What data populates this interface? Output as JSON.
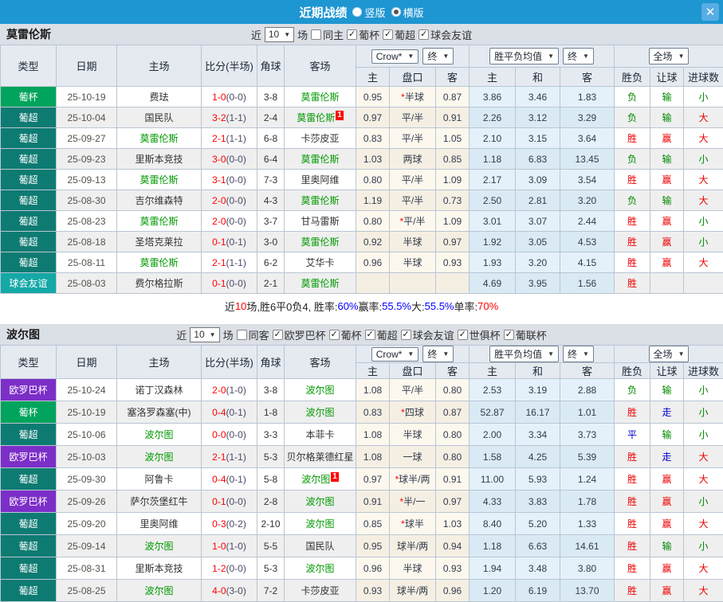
{
  "titlebar": {
    "title": "近期战绩",
    "options": [
      {
        "label": "竖版",
        "checked": false
      },
      {
        "label": "横版",
        "checked": true
      }
    ],
    "close_icon": "✕",
    "bar_color": "#1e96d2"
  },
  "headers": {
    "main": [
      "类型",
      "日期",
      "主场",
      "比分(半场)",
      "角球",
      "客场"
    ],
    "odds_sub": [
      "主",
      "盘口",
      "客"
    ],
    "mean_sub": [
      "主",
      "和",
      "客"
    ],
    "result_sub": [
      "胜负",
      "让球",
      "进球数"
    ],
    "odds_dropdown": "Crow*",
    "odds_final_dropdown": "终",
    "mean_dropdown": "胜平负均值",
    "mean_final_dropdown": "终",
    "scope_dropdown": "全场",
    "arrow_icon": "▼",
    "check_icon": "✓"
  },
  "type_colors": {
    "葡杯": "#00a45c",
    "葡超": "#0e7b72",
    "球会友谊": "#14a8a6",
    "欧罗巴杯": "#7c2fc8"
  },
  "sections": [
    {
      "team": "莫雷伦斯",
      "filter": {
        "prefix": "近",
        "count": "10",
        "suffix": "场",
        "same": {
          "label": "同主",
          "checked": false
        },
        "leagues": [
          {
            "label": "葡杯",
            "checked": true
          },
          {
            "label": "葡超",
            "checked": true
          },
          {
            "label": "球会友谊",
            "checked": true
          }
        ]
      },
      "rows": [
        {
          "type": "葡杯",
          "date": "25-10-19",
          "home": {
            "name": "费珐",
            "self": false,
            "card": ""
          },
          "score": "1-0",
          "half": "0-0",
          "corner": "3-8",
          "away": {
            "name": "莫雷伦斯",
            "self": true,
            "card": ""
          },
          "odds": [
            "0.95",
            "*半球",
            "0.87"
          ],
          "mean": [
            "3.86",
            "3.46",
            "1.83"
          ],
          "result": [
            "负",
            "输",
            "小"
          ]
        },
        {
          "type": "葡超",
          "date": "25-10-04",
          "home": {
            "name": "国民队",
            "self": false,
            "card": ""
          },
          "score": "3-2",
          "half": "1-1",
          "corner": "2-4",
          "away": {
            "name": "莫雷伦斯",
            "self": true,
            "card": "1"
          },
          "odds": [
            "0.97",
            "平/半",
            "0.91"
          ],
          "mean": [
            "2.26",
            "3.12",
            "3.29"
          ],
          "result": [
            "负",
            "输",
            "大"
          ]
        },
        {
          "type": "葡超",
          "date": "25-09-27",
          "home": {
            "name": "莫雷伦斯",
            "self": true,
            "card": ""
          },
          "score": "2-1",
          "half": "1-1",
          "corner": "6-8",
          "away": {
            "name": "卡莎皮亚",
            "self": false,
            "card": ""
          },
          "odds": [
            "0.83",
            "平/半",
            "1.05"
          ],
          "mean": [
            "2.10",
            "3.15",
            "3.64"
          ],
          "result": [
            "胜",
            "赢",
            "大"
          ]
        },
        {
          "type": "葡超",
          "date": "25-09-23",
          "home": {
            "name": "里斯本竞技",
            "self": false,
            "card": ""
          },
          "score": "3-0",
          "half": "0-0",
          "corner": "6-4",
          "away": {
            "name": "莫雷伦斯",
            "self": true,
            "card": ""
          },
          "odds": [
            "1.03",
            "两球",
            "0.85"
          ],
          "mean": [
            "1.18",
            "6.83",
            "13.45"
          ],
          "result": [
            "负",
            "输",
            "小"
          ]
        },
        {
          "type": "葡超",
          "date": "25-09-13",
          "home": {
            "name": "莫雷伦斯",
            "self": true,
            "card": ""
          },
          "score": "3-1",
          "half": "0-0",
          "corner": "7-3",
          "away": {
            "name": "里奥阿维",
            "self": false,
            "card": ""
          },
          "odds": [
            "0.80",
            "平/半",
            "1.09"
          ],
          "mean": [
            "2.17",
            "3.09",
            "3.54"
          ],
          "result": [
            "胜",
            "赢",
            "大"
          ]
        },
        {
          "type": "葡超",
          "date": "25-08-30",
          "home": {
            "name": "吉尔维森特",
            "self": false,
            "card": ""
          },
          "score": "2-0",
          "half": "0-0",
          "corner": "4-3",
          "away": {
            "name": "莫雷伦斯",
            "self": true,
            "card": ""
          },
          "odds": [
            "1.19",
            "平/半",
            "0.73"
          ],
          "mean": [
            "2.50",
            "2.81",
            "3.20"
          ],
          "result": [
            "负",
            "输",
            "大"
          ]
        },
        {
          "type": "葡超",
          "date": "25-08-23",
          "home": {
            "name": "莫雷伦斯",
            "self": true,
            "card": ""
          },
          "score": "2-0",
          "half": "0-0",
          "corner": "3-7",
          "away": {
            "name": "甘马雷斯",
            "self": false,
            "card": ""
          },
          "odds": [
            "0.80",
            "*平/半",
            "1.09"
          ],
          "mean": [
            "3.01",
            "3.07",
            "2.44"
          ],
          "result": [
            "胜",
            "赢",
            "小"
          ]
        },
        {
          "type": "葡超",
          "date": "25-08-18",
          "home": {
            "name": "圣塔克莱拉",
            "self": false,
            "card": ""
          },
          "score": "0-1",
          "half": "0-1",
          "corner": "3-0",
          "away": {
            "name": "莫雷伦斯",
            "self": true,
            "card": ""
          },
          "odds": [
            "0.92",
            "半球",
            "0.97"
          ],
          "mean": [
            "1.92",
            "3.05",
            "4.53"
          ],
          "result": [
            "胜",
            "赢",
            "小"
          ]
        },
        {
          "type": "葡超",
          "date": "25-08-11",
          "home": {
            "name": "莫雷伦斯",
            "self": true,
            "card": ""
          },
          "score": "2-1",
          "half": "1-1",
          "corner": "6-2",
          "away": {
            "name": "艾华卡",
            "self": false,
            "card": ""
          },
          "odds": [
            "0.96",
            "半球",
            "0.93"
          ],
          "mean": [
            "1.93",
            "3.20",
            "4.15"
          ],
          "result": [
            "胜",
            "赢",
            "大"
          ]
        },
        {
          "type": "球会友谊",
          "date": "25-08-03",
          "home": {
            "name": "费尔格拉斯",
            "self": false,
            "card": ""
          },
          "score": "0-1",
          "half": "0-0",
          "corner": "2-1",
          "away": {
            "name": "莫雷伦斯",
            "self": true,
            "card": ""
          },
          "odds": [
            "",
            "",
            ""
          ],
          "mean": [
            "4.69",
            "3.95",
            "1.56"
          ],
          "result": [
            "胜",
            "",
            ""
          ]
        }
      ],
      "summary": [
        {
          "text": "近",
          "color": "dark"
        },
        {
          "text": "10",
          "color": "red"
        },
        {
          "text": "场,胜6平0负4, 胜率:",
          "color": "dark"
        },
        {
          "text": "60%",
          "color": "blue"
        },
        {
          "text": " 赢率:",
          "color": "dark"
        },
        {
          "text": "55.5%",
          "color": "blue"
        },
        {
          "text": " 大:",
          "color": "dark"
        },
        {
          "text": "55.5%",
          "color": "blue"
        },
        {
          "text": " 单率:",
          "color": "dark"
        },
        {
          "text": "70%",
          "color": "red"
        }
      ]
    },
    {
      "team": "波尔图",
      "filter": {
        "prefix": "近",
        "count": "10",
        "suffix": "场",
        "same": {
          "label": "同客",
          "checked": false
        },
        "leagues": [
          {
            "label": "欧罗巴杯",
            "checked": true
          },
          {
            "label": "葡杯",
            "checked": true
          },
          {
            "label": "葡超",
            "checked": true
          },
          {
            "label": "球会友谊",
            "checked": true
          },
          {
            "label": "世俱杯",
            "checked": true
          },
          {
            "label": "葡联杯",
            "checked": true
          }
        ]
      },
      "rows": [
        {
          "type": "欧罗巴杯",
          "date": "25-10-24",
          "home": {
            "name": "诺丁汉森林",
            "self": false,
            "card": ""
          },
          "score": "2-0",
          "half": "1-0",
          "corner": "3-8",
          "away": {
            "name": "波尔图",
            "self": true,
            "card": ""
          },
          "odds": [
            "1.08",
            "平/半",
            "0.80"
          ],
          "mean": [
            "2.53",
            "3.19",
            "2.88"
          ],
          "result": [
            "负",
            "输",
            "小"
          ]
        },
        {
          "type": "葡杯",
          "date": "25-10-19",
          "home": {
            "name": "塞洛罗森塞(中)",
            "self": false,
            "card": ""
          },
          "score": "0-4",
          "half": "0-1",
          "corner": "1-8",
          "away": {
            "name": "波尔图",
            "self": true,
            "card": ""
          },
          "odds": [
            "0.83",
            "*四球",
            "0.87"
          ],
          "mean": [
            "52.87",
            "16.17",
            "1.01"
          ],
          "result": [
            "胜",
            "走",
            "小"
          ]
        },
        {
          "type": "葡超",
          "date": "25-10-06",
          "home": {
            "name": "波尔图",
            "self": true,
            "card": ""
          },
          "score": "0-0",
          "half": "0-0",
          "corner": "3-3",
          "away": {
            "name": "本菲卡",
            "self": false,
            "card": ""
          },
          "odds": [
            "1.08",
            "半球",
            "0.80"
          ],
          "mean": [
            "2.00",
            "3.34",
            "3.73"
          ],
          "result": [
            "平",
            "输",
            "小"
          ]
        },
        {
          "type": "欧罗巴杯",
          "date": "25-10-03",
          "home": {
            "name": "波尔图",
            "self": true,
            "card": ""
          },
          "score": "2-1",
          "half": "1-1",
          "corner": "5-3",
          "away": {
            "name": "贝尔格莱德红星",
            "self": false,
            "card": ""
          },
          "odds": [
            "1.08",
            "一球",
            "0.80"
          ],
          "mean": [
            "1.58",
            "4.25",
            "5.39"
          ],
          "result": [
            "胜",
            "走",
            "大"
          ]
        },
        {
          "type": "葡超",
          "date": "25-09-30",
          "home": {
            "name": "阿鲁卡",
            "self": false,
            "card": ""
          },
          "score": "0-4",
          "half": "0-1",
          "corner": "5-8",
          "away": {
            "name": "波尔图",
            "self": true,
            "card": "1"
          },
          "odds": [
            "0.97",
            "*球半/两",
            "0.91"
          ],
          "mean": [
            "11.00",
            "5.93",
            "1.24"
          ],
          "result": [
            "胜",
            "赢",
            "大"
          ]
        },
        {
          "type": "欧罗巴杯",
          "date": "25-09-26",
          "home": {
            "name": "萨尔茨堡红牛",
            "self": false,
            "card": ""
          },
          "score": "0-1",
          "half": "0-0",
          "corner": "2-8",
          "away": {
            "name": "波尔图",
            "self": true,
            "card": ""
          },
          "odds": [
            "0.91",
            "*半/一",
            "0.97"
          ],
          "mean": [
            "4.33",
            "3.83",
            "1.78"
          ],
          "result": [
            "胜",
            "赢",
            "小"
          ]
        },
        {
          "type": "葡超",
          "date": "25-09-20",
          "home": {
            "name": "里奥阿维",
            "self": false,
            "card": ""
          },
          "score": "0-3",
          "half": "0-2",
          "corner": "2-10",
          "away": {
            "name": "波尔图",
            "self": true,
            "card": ""
          },
          "odds": [
            "0.85",
            "*球半",
            "1.03"
          ],
          "mean": [
            "8.40",
            "5.20",
            "1.33"
          ],
          "result": [
            "胜",
            "赢",
            "大"
          ]
        },
        {
          "type": "葡超",
          "date": "25-09-14",
          "home": {
            "name": "波尔图",
            "self": true,
            "card": ""
          },
          "score": "1-0",
          "half": "1-0",
          "corner": "5-5",
          "away": {
            "name": "国民队",
            "self": false,
            "card": ""
          },
          "odds": [
            "0.95",
            "球半/两",
            "0.94"
          ],
          "mean": [
            "1.18",
            "6.63",
            "14.61"
          ],
          "result": [
            "胜",
            "输",
            "小"
          ]
        },
        {
          "type": "葡超",
          "date": "25-08-31",
          "home": {
            "name": "里斯本竞技",
            "self": false,
            "card": ""
          },
          "score": "1-2",
          "half": "0-0",
          "corner": "5-3",
          "away": {
            "name": "波尔图",
            "self": true,
            "card": ""
          },
          "odds": [
            "0.96",
            "半球",
            "0.93"
          ],
          "mean": [
            "1.94",
            "3.48",
            "3.80"
          ],
          "result": [
            "胜",
            "赢",
            "大"
          ]
        },
        {
          "type": "葡超",
          "date": "25-08-25",
          "home": {
            "name": "波尔图",
            "self": true,
            "card": ""
          },
          "score": "4-0",
          "half": "3-0",
          "corner": "7-2",
          "away": {
            "name": "卡莎皮亚",
            "self": false,
            "card": ""
          },
          "odds": [
            "0.93",
            "球半/两",
            "0.96"
          ],
          "mean": [
            "1.20",
            "6.19",
            "13.70"
          ],
          "result": [
            "胜",
            "赢",
            "大"
          ]
        }
      ],
      "summary": null
    }
  ]
}
